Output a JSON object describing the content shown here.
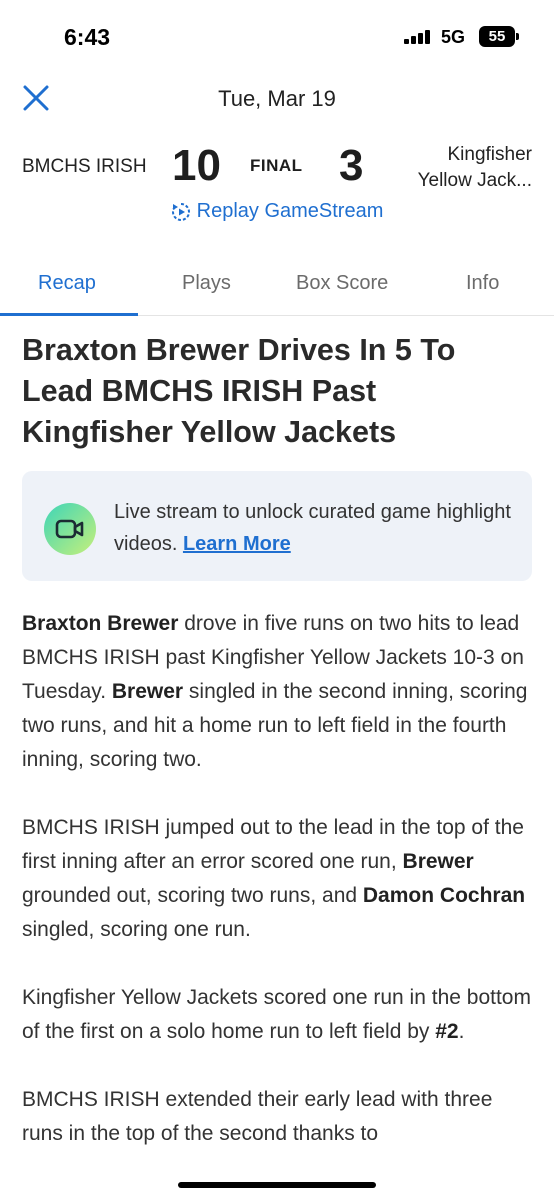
{
  "status_bar": {
    "time": "6:43",
    "network": "5G",
    "battery": "55"
  },
  "header": {
    "date": "Tue, Mar 19"
  },
  "scoreboard": {
    "home_team": "BMCHS IRISH",
    "home_score": "10",
    "status": "FINAL",
    "away_score": "3",
    "away_team_line1": "Kingfisher",
    "away_team_line2": "Yellow Jack..."
  },
  "replay": {
    "label": "Replay GameStream"
  },
  "tabs": [
    {
      "label": "Recap",
      "active": true
    },
    {
      "label": "Plays",
      "active": false
    },
    {
      "label": "Box Score",
      "active": false
    },
    {
      "label": "Info",
      "active": false
    }
  ],
  "headline": "Braxton Brewer Drives In 5 To Lead BMCHS IRISH Past Kingfisher Yellow Jackets",
  "promo": {
    "text": "Live stream to unlock curated game highlight videos.",
    "link": "Learn More",
    "icon": "video-camera-icon"
  },
  "article": {
    "p1": {
      "name1": "Braxton Brewer",
      "text1": " drove in five runs on two hits to lead BMCHS IRISH past Kingfisher Yellow Jackets 10-3 on Tuesday. ",
      "name2": "Brewer",
      "text2": " singled in the second inning, scoring two runs, and hit a home run to left field in the fourth inning, scoring two."
    },
    "p2": {
      "text1": "BMCHS IRISH jumped out to the lead in the top of the first inning after an error scored one run, ",
      "name1": "Brewer",
      "text2": " grounded out, scoring two runs, and ",
      "name2": "Damon Cochran",
      "text3": " singled, scoring one run."
    },
    "p3": {
      "text1": "Kingfisher Yellow Jackets scored one run in the bottom of the first on a solo home run to left field by ",
      "name1": "#2",
      "text2": "."
    },
    "p4": {
      "text1": "BMCHS IRISH extended their early lead with three runs in the top of the second thanks to"
    }
  },
  "colors": {
    "accent": "#1f6fd0",
    "promo_bg": "#eef2f8"
  }
}
